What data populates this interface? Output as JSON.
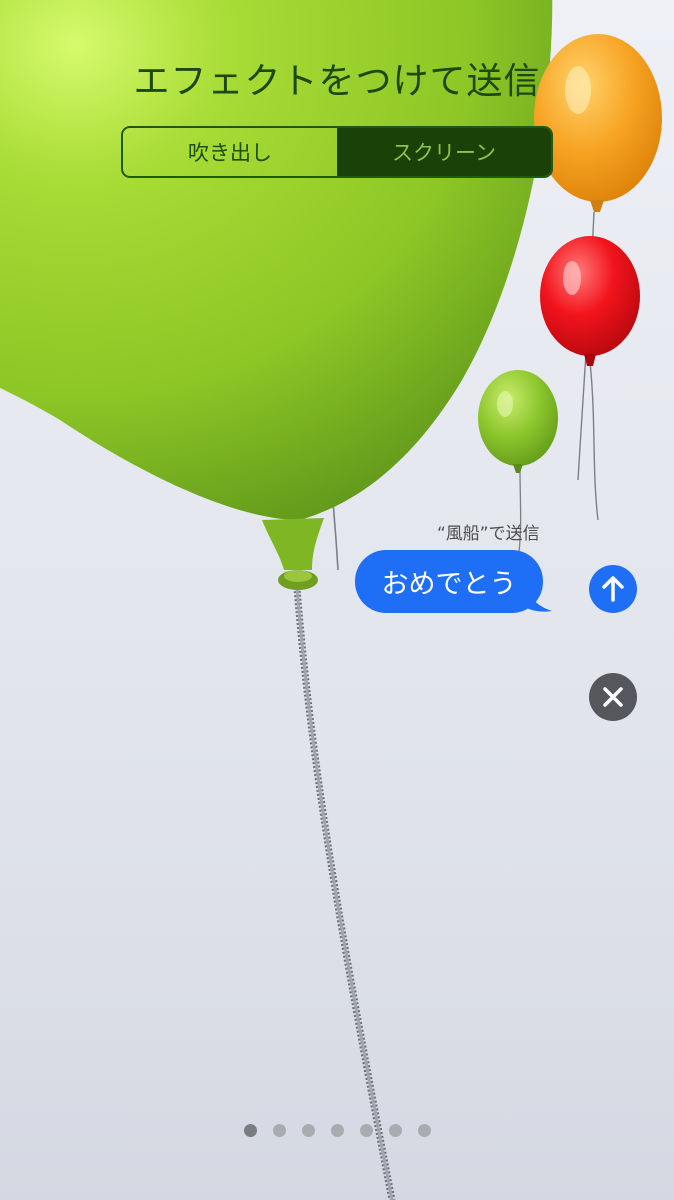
{
  "header": {
    "title": "エフェクトをつけて送信",
    "tabs": [
      {
        "label": "吹き出し",
        "selected": false
      },
      {
        "label": "スクリーン",
        "selected": true
      }
    ]
  },
  "effect": {
    "name": "風船",
    "caption": "“風船”で送信"
  },
  "message": {
    "text": "おめでとう"
  },
  "actions": {
    "send_icon": "arrow-up-icon",
    "cancel_icon": "close-icon"
  },
  "pagination": {
    "count": 7,
    "active_index": 0
  },
  "colors": {
    "bubble": "#1f6ef6",
    "cancel": "#55575c",
    "selected_tab": "#1a4108",
    "balloon_green": "#8bc92a",
    "balloon_orange": "#f5a623",
    "balloon_red": "#e8121a"
  }
}
